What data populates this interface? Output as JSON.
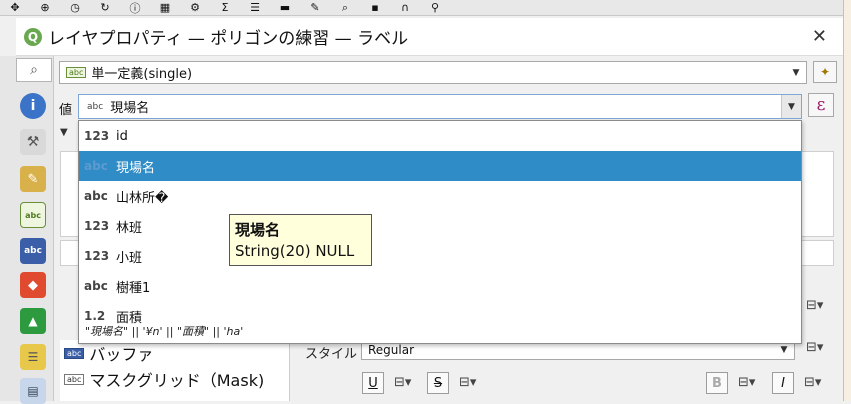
{
  "window": {
    "title": "レイヤプロパティ — ポリゴンの練習 — ラベル",
    "logo": "Q",
    "close_label": "✕"
  },
  "toolbar_icons": [
    "pan-icon",
    "zoom-icon",
    "clock-icon",
    "refresh-icon",
    "identify-icon",
    "table-icon",
    "gear-icon",
    "sigma-icon",
    "attribute-table-icon",
    "measure-icon",
    "annotation-icon",
    "search-icon",
    "save-icon",
    "magnet-icon",
    "node-icon"
  ],
  "labels_mode": {
    "badge": "abc",
    "value": "単一定義(single)"
  },
  "value_field": {
    "label": "値",
    "badge": "abc",
    "value": "現場名",
    "expression_symbol": "ε"
  },
  "dropdown": {
    "items": [
      {
        "type": "123",
        "name": "id",
        "selected": false
      },
      {
        "type": "abc",
        "name": "現場名",
        "selected": true
      },
      {
        "type": "abc",
        "name": "山林所�",
        "selected": false
      },
      {
        "type": "123",
        "name": "林班",
        "selected": false
      },
      {
        "type": "123",
        "name": "小班",
        "selected": false
      },
      {
        "type": "abc",
        "name": "樹種1",
        "selected": false
      },
      {
        "type": "1.2",
        "name": "面積",
        "selected": false
      }
    ],
    "expression": "\"現場名\" || '¥n' || \"面積\" || 'ha'"
  },
  "tooltip": {
    "name": "現場名",
    "type": "String(20) NULL"
  },
  "side_panel": {
    "items": [
      {
        "label": "バッファ",
        "icon": "buffer-icon"
      },
      {
        "label": "マスクグリッド（Mask)",
        "icon": "mask-icon"
      }
    ]
  },
  "style": {
    "label": "スタイル",
    "value": "Regular"
  },
  "format_buttons": {
    "underline": "U",
    "strikeout": "S",
    "bold": "B",
    "italic": "I"
  },
  "colors": {
    "selected": "#308cc6",
    "tooltip_bg": "#ffffdc",
    "accent_green": "#6aa84f"
  }
}
